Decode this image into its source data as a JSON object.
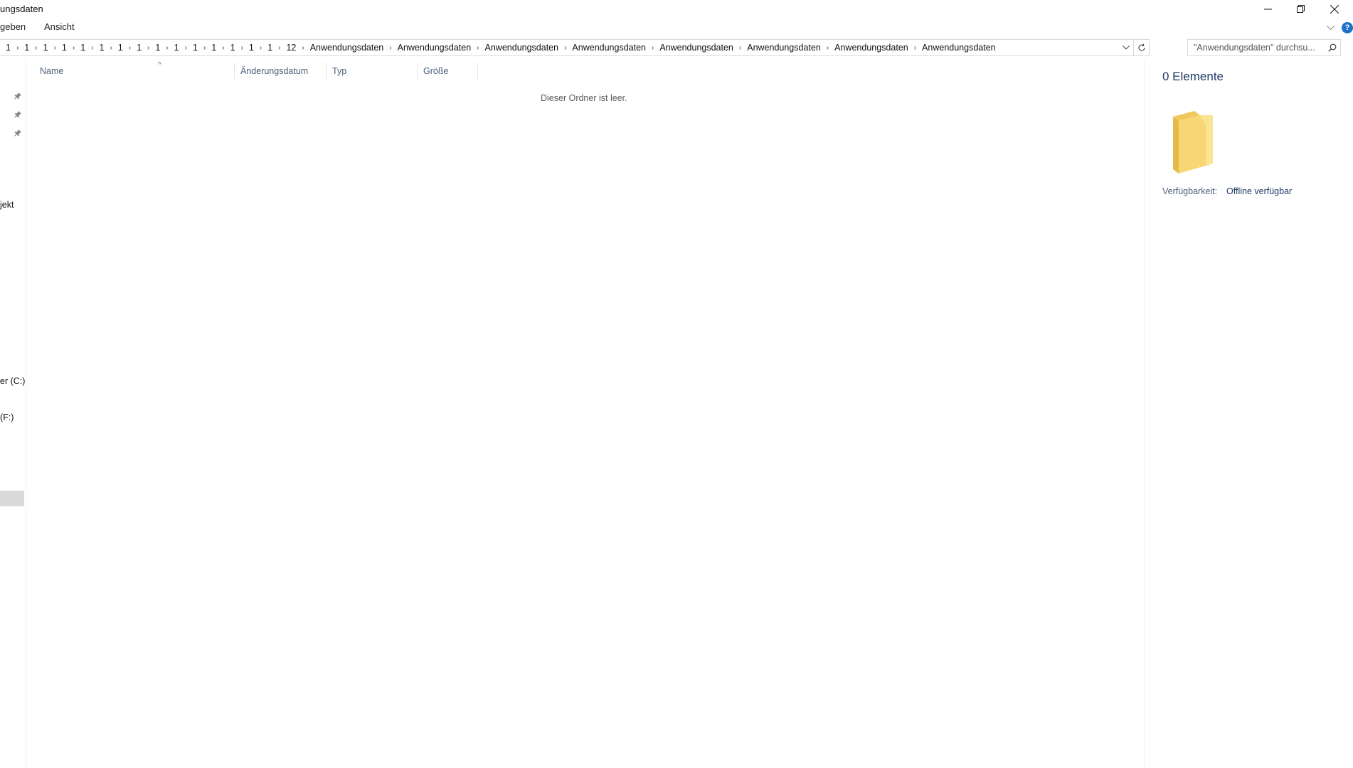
{
  "window": {
    "title": "ungsdaten"
  },
  "ribbon": {
    "tabs": [
      "geben",
      "Ansicht"
    ]
  },
  "address": {
    "crumbs": [
      "1",
      "1",
      "1",
      "1",
      "1",
      "1",
      "1",
      "1",
      "1",
      "1",
      "1",
      "1",
      "1",
      "1",
      "1",
      "12",
      "Anwendungsdaten",
      "Anwendungsdaten",
      "Anwendungsdaten",
      "Anwendungsdaten",
      "Anwendungsdaten",
      "Anwendungsdaten",
      "Anwendungsdaten",
      "Anwendungsdaten"
    ]
  },
  "search": {
    "placeholder": "\"Anwendungsdaten\" durchsu..."
  },
  "nav": {
    "item_project": "jekt",
    "item_drive_c": "er (C:)",
    "item_drive_f": "(F:)"
  },
  "columns": {
    "name": "Name",
    "modified": "Änderungsdatum",
    "type": "Typ",
    "size": "Größe"
  },
  "content": {
    "empty_message": "Dieser Ordner ist leer."
  },
  "details": {
    "count": "0 Elemente",
    "availability_label": "Verfügbarkeit:",
    "availability_value": "Offline verfügbar"
  },
  "colors": {
    "folder": "#f7d774",
    "accent_blue": "#1e73c8",
    "header_text": "#4c607a",
    "details_title": "#1f3c64"
  }
}
